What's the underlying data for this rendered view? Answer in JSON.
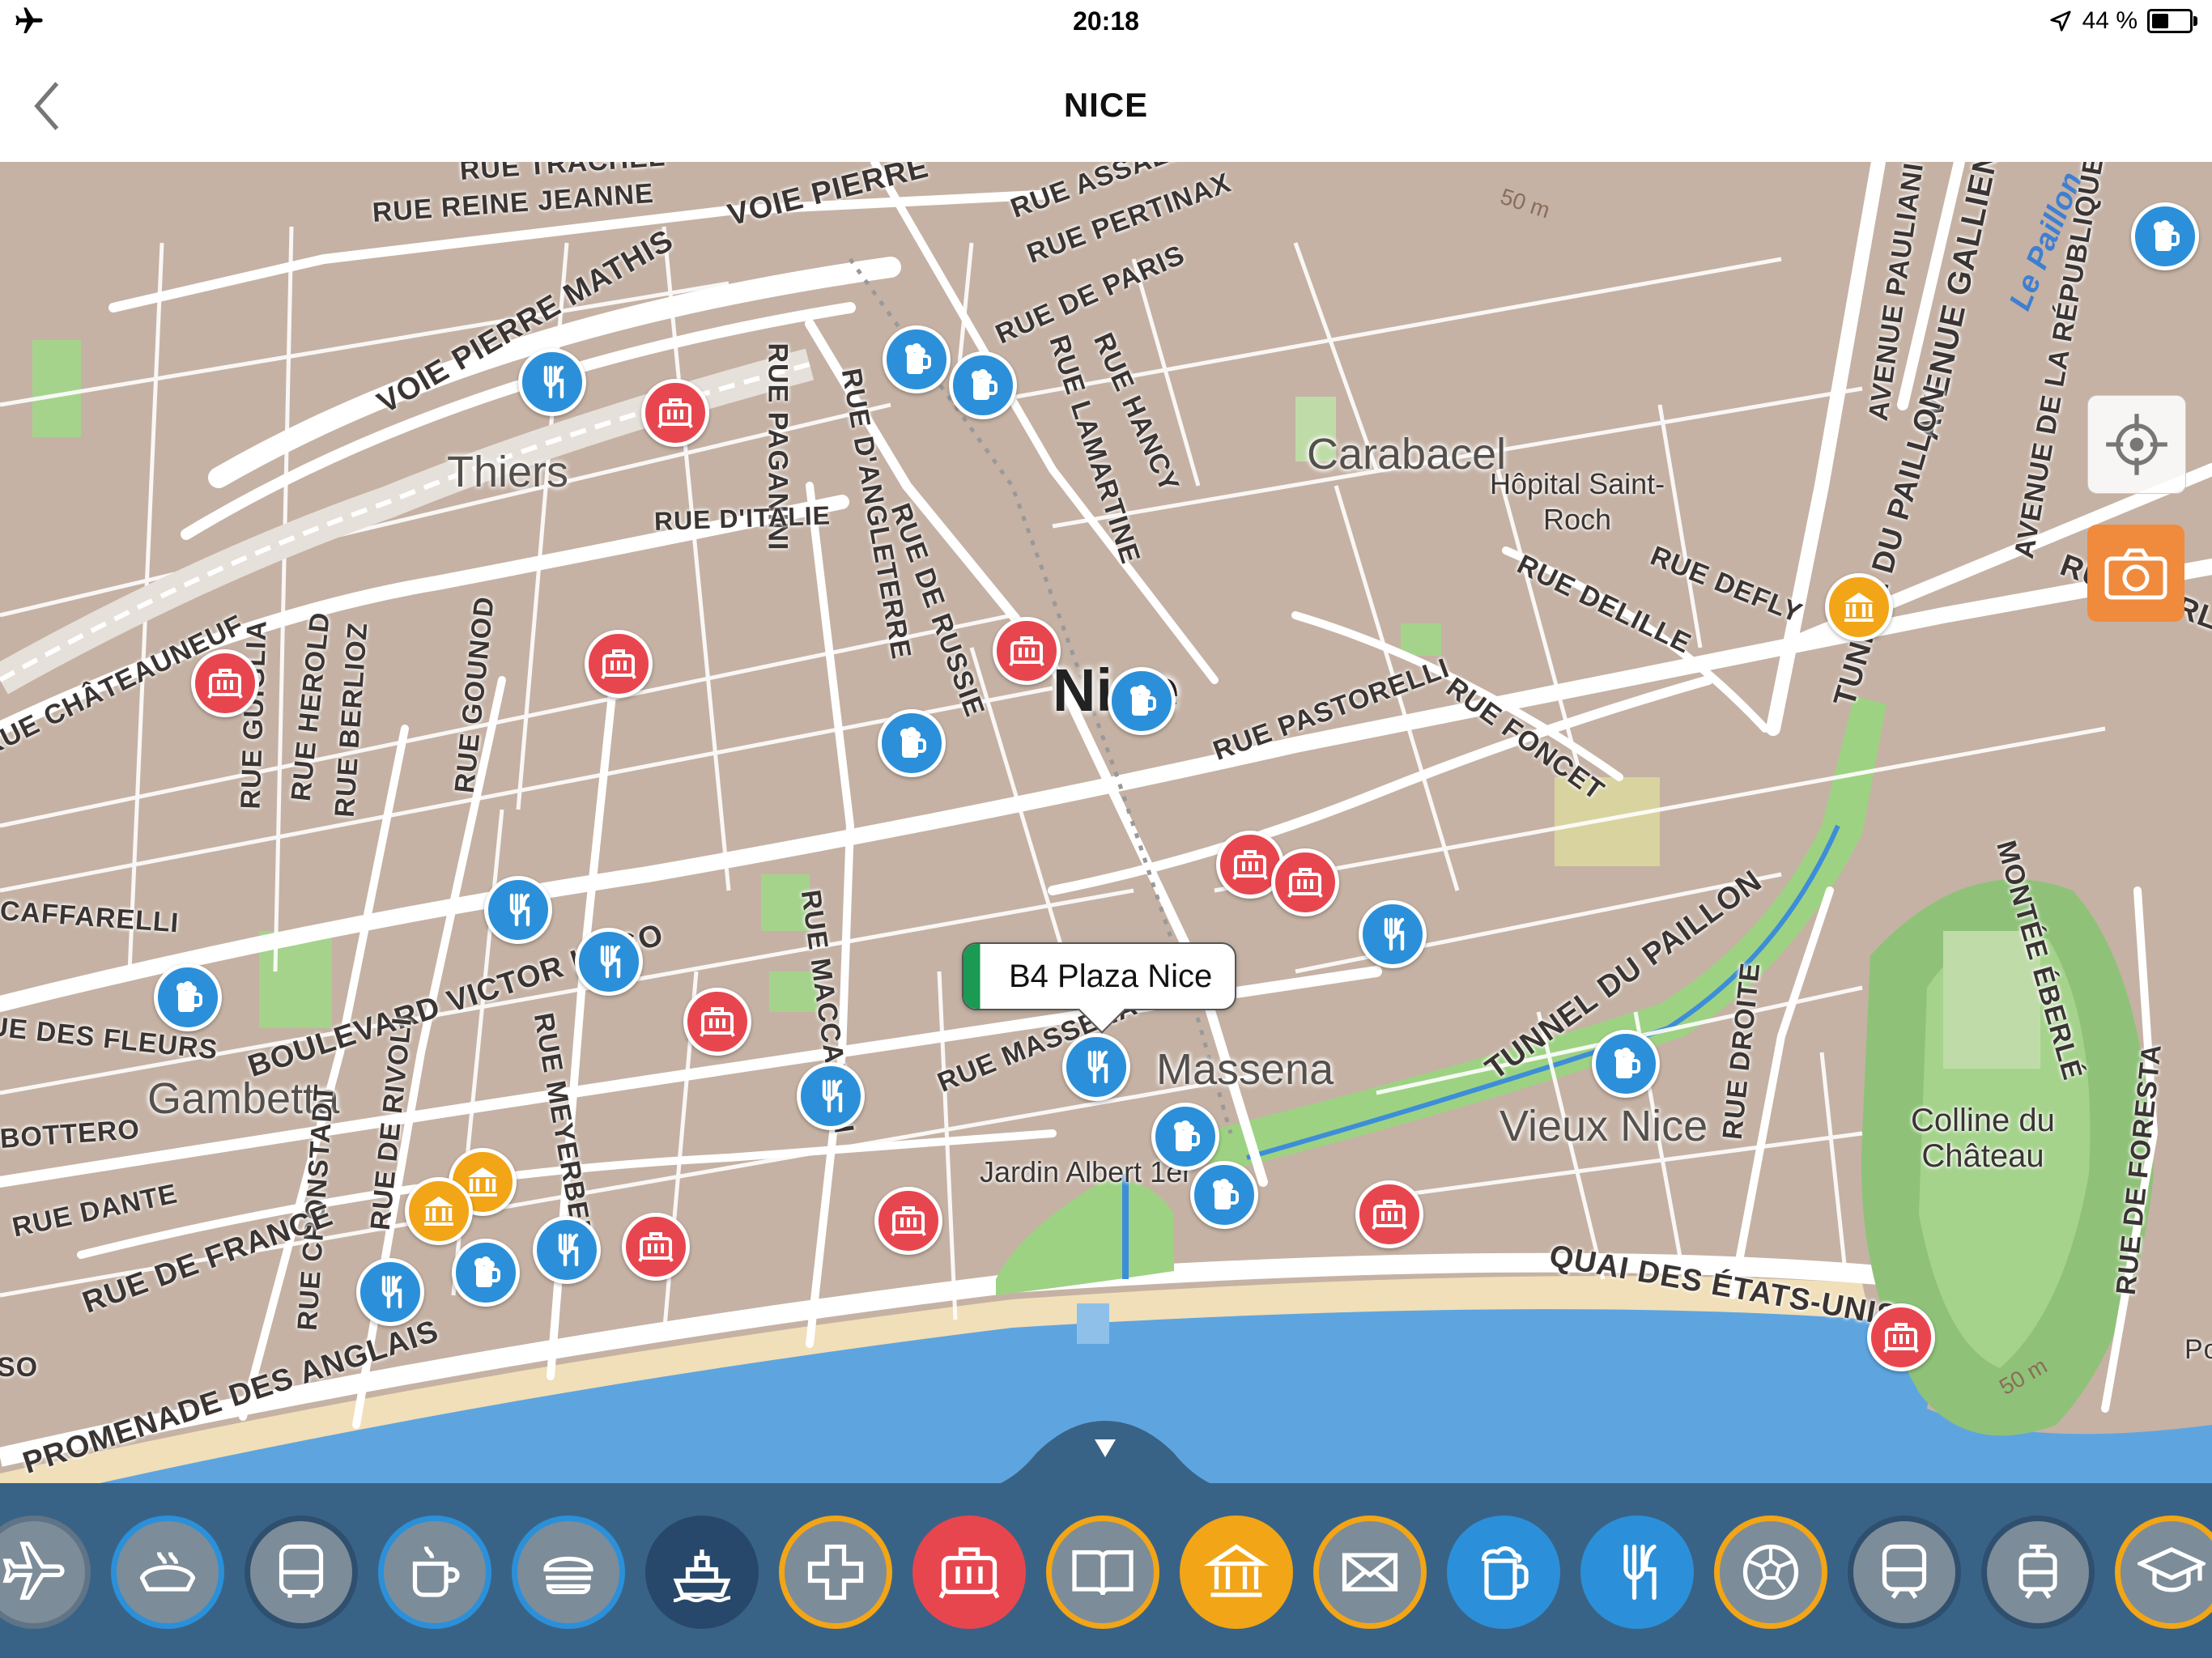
{
  "status_bar": {
    "time": "20:18",
    "battery_text": "44 %",
    "icons": [
      "airplane-mode-icon",
      "location-arrow-icon",
      "battery-icon"
    ]
  },
  "nav": {
    "title": "NICE",
    "back_icon": "chevron-left-icon"
  },
  "map": {
    "city_label": "Nice",
    "districts": [
      {
        "name": "Thiers"
      },
      {
        "name": "Carabacel"
      },
      {
        "name": "Gambetta"
      },
      {
        "name": "Massena"
      },
      {
        "name": "Vieux Nice"
      }
    ],
    "pois": [
      {
        "name": "Hôpital Saint-\nRoch"
      },
      {
        "name": "Jardin Albert 1er"
      },
      {
        "name": "Colline du\nChâteau"
      }
    ],
    "water_labels": [
      "Le Paillon"
    ],
    "contours": [
      "50 m",
      "50 m"
    ],
    "streets": [
      "RUE TRACHEL",
      "RUE REINE JEANNE",
      "VOIE PIERRE",
      "VOIE PIERRE MATHIS",
      "RUE ASSALIT",
      "RUE PERTINAX",
      "RUE DE PARIS",
      "RUE PAGANINI",
      "RUE D'ANGLETERRE",
      "RUE LAMARTINE",
      "RUE HANCY",
      "RUE D'ITALIE",
      "RUE DE RUSSIE",
      "AVENUE PAULIANI",
      "AVENUE GALLIENI",
      "TUNNEL DU PAILLON",
      "AVENUE DE LA RÉPUBLIQUE",
      "RUE BARLA",
      "RUE DELILLE",
      "RUE DEFLY",
      "RUE CHÂTEAUNEUF",
      "RUE GUIGLIA",
      "RUE HEROLD",
      "RUE BERLIOZ",
      "RUE GOUNOD",
      "RUE PASTORELLI",
      "RUE FONCET",
      "CAFFARELLI",
      "BOULEVARD VICTOR HUGO",
      "RUE DES FLEURS",
      "RUE MACCARANI",
      "RUE MASSENA",
      "TUNNEL DU PAILLON",
      "MONTÉE ÉBERLÉ",
      "RUE DROITE",
      "BOTTERO",
      "RUE MEYERBEER",
      "RUE DE RIVOLI",
      "RUE CRONSTADT",
      "RUE DANTE",
      "RUE DE FRANCE",
      "QUAI DES ÉTATS-UNIS",
      "RUE DE FORESTA",
      "PROMENADE DES ANGLAIS",
      "SO",
      "Po"
    ],
    "callout": {
      "name": "B4 Plaza Nice"
    },
    "markers": [
      {
        "type": "restaurant",
        "color": "#2b90d9"
      },
      {
        "type": "hotel",
        "color": "#e8464f"
      },
      {
        "type": "bar",
        "color": "#2b90d9"
      },
      {
        "type": "bar",
        "color": "#2b90d9"
      },
      {
        "type": "bar",
        "color": "#2b90d9"
      },
      {
        "type": "hotel",
        "color": "#e8464f"
      },
      {
        "type": "hotel",
        "color": "#e8464f"
      },
      {
        "type": "hotel",
        "color": "#e8464f"
      },
      {
        "type": "bar",
        "color": "#2b90d9"
      },
      {
        "type": "hotel",
        "color": "#e8464f"
      },
      {
        "type": "hotel",
        "color": "#e8464f"
      },
      {
        "type": "hotel",
        "color": "#e8464f"
      },
      {
        "type": "restaurant",
        "color": "#2b90d9"
      },
      {
        "type": "restaurant",
        "color": "#2b90d9"
      },
      {
        "type": "restaurant",
        "color": "#2b90d9"
      },
      {
        "type": "museum",
        "color": "#f2a516"
      },
      {
        "type": "bar",
        "color": "#2b90d9"
      },
      {
        "type": "restaurant",
        "color": "#2b90d9"
      },
      {
        "type": "restaurant",
        "color": "#2b90d9"
      },
      {
        "type": "bar",
        "color": "#2b90d9"
      },
      {
        "type": "bar",
        "color": "#2b90d9"
      },
      {
        "type": "bar",
        "color": "#2b90d9"
      },
      {
        "type": "hotel",
        "color": "#e8464f"
      },
      {
        "type": "hotel",
        "color": "#e8464f"
      },
      {
        "type": "museum",
        "color": "#f2a516"
      },
      {
        "type": "museum",
        "color": "#f2a516"
      },
      {
        "type": "bar",
        "color": "#2b90d9"
      },
      {
        "type": "restaurant",
        "color": "#2b90d9"
      },
      {
        "type": "restaurant",
        "color": "#2b90d9"
      },
      {
        "type": "hotel",
        "color": "#e8464f"
      },
      {
        "type": "hotel",
        "color": "#e8464f"
      },
      {
        "type": "bar",
        "color": "#2b90d9"
      }
    ]
  },
  "controls": {
    "locate_icon": "crosshair-locate-icon",
    "camera_icon": "camera-icon",
    "collapse_icon": "triangle-down-icon"
  },
  "categories": [
    {
      "icon": "airplane-icon",
      "fill": "#7d8c99",
      "ring": "#5f7486",
      "selected": false
    },
    {
      "icon": "bakery-icon",
      "fill": "#7d8c99",
      "ring": "#2b90d9",
      "selected": false
    },
    {
      "icon": "bus-icon",
      "fill": "#7d8c99",
      "ring": "#2f4f6e",
      "selected": false
    },
    {
      "icon": "coffee-icon",
      "fill": "#7d8c99",
      "ring": "#2b90d9",
      "selected": false
    },
    {
      "icon": "burger-icon",
      "fill": "#7d8c99",
      "ring": "#2b90d9",
      "selected": false
    },
    {
      "icon": "ferry-icon",
      "fill": "#27486a",
      "ring": "#27486a",
      "selected": true
    },
    {
      "icon": "medical-cross-icon",
      "fill": "#7d8c99",
      "ring": "#f2a516",
      "selected": false
    },
    {
      "icon": "hotel-luggage-icon",
      "fill": "#e8464f",
      "ring": "#e8464f",
      "selected": true
    },
    {
      "icon": "book-icon",
      "fill": "#7d8c99",
      "ring": "#f2a516",
      "selected": false
    },
    {
      "icon": "museum-icon",
      "fill": "#f2a516",
      "ring": "#f2a516",
      "selected": true
    },
    {
      "icon": "mail-icon",
      "fill": "#7d8c99",
      "ring": "#f2a516",
      "selected": false
    },
    {
      "icon": "beer-icon",
      "fill": "#2b90d9",
      "ring": "#2b90d9",
      "selected": true
    },
    {
      "icon": "restaurant-icon",
      "fill": "#2b90d9",
      "ring": "#2b90d9",
      "selected": true
    },
    {
      "icon": "soccer-ball-icon",
      "fill": "#7d8c99",
      "ring": "#f2a516",
      "selected": false
    },
    {
      "icon": "train-icon",
      "fill": "#7d8c99",
      "ring": "#2f4f6e",
      "selected": false
    },
    {
      "icon": "tram-icon",
      "fill": "#7d8c99",
      "ring": "#2f4f6e",
      "selected": false
    },
    {
      "icon": "graduation-cap-icon",
      "fill": "#7d8c99",
      "ring": "#f2a516",
      "selected": false
    }
  ]
}
